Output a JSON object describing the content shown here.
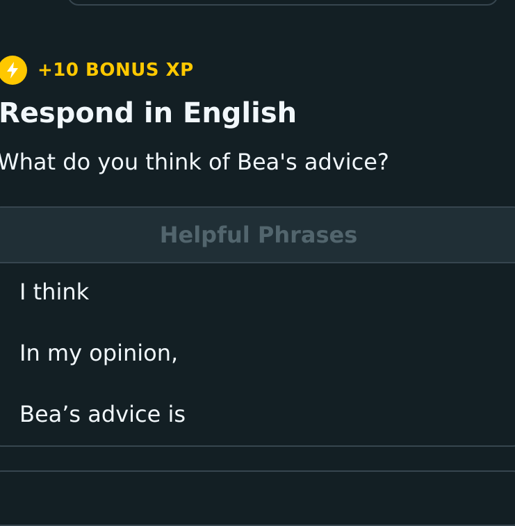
{
  "bonus": {
    "icon": "lightning-bolt-icon",
    "text": "+10 BONUS XP",
    "color": "#ffc800"
  },
  "exercise": {
    "title": "Respond in English",
    "question": "What do you think of Bea's advice?"
  },
  "helpful_phrases": {
    "header": "Helpful Phrases",
    "items": [
      "I think",
      "In my opinion,",
      "Bea’s advice is"
    ]
  },
  "colors": {
    "background": "#131f24",
    "card_border": "#37464f",
    "card_header_bg": "#202f36",
    "header_text": "#52656d",
    "text": "#f1f7fb"
  }
}
